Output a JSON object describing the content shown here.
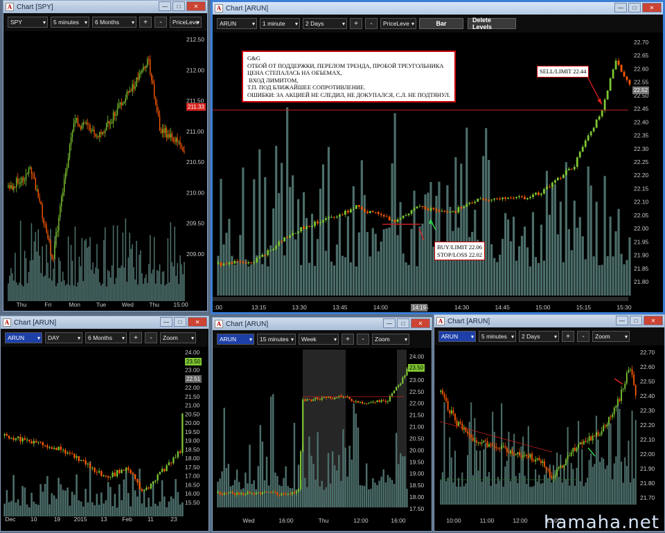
{
  "colors": {
    "up": "#7fc832",
    "down": "#ff5a00",
    "vol": "#4c6e6a",
    "level": "#cc2020"
  },
  "windows": {
    "spy": {
      "title": "Chart [SPY]",
      "symbol": "SPY",
      "interval": "5 minutes",
      "range": "6 Months",
      "price_type": "PriceLeve",
      "current_price": "211.33",
      "y_labels": [
        "212.50",
        "212.00",
        "211.50",
        "211.00",
        "210.50",
        "210.00",
        "209.50",
        "209.00"
      ],
      "x_labels": [
        "Thu",
        "Fri",
        "Mon",
        "Tue",
        "Wed",
        "Thu",
        "15:00"
      ]
    },
    "main": {
      "title": "Chart [ARUN]",
      "symbol": "ARUN",
      "interval": "1 minute",
      "range": "2 Days",
      "price_type": "PriceLeve",
      "bar_button": "Bar",
      "delete_button": "Delete Levels",
      "current_price": "22.52",
      "y_labels": [
        "22.70",
        "22.65",
        "22.60",
        "22.55",
        "22.50",
        "22.45",
        "22.40",
        "22.35",
        "22.30",
        "22.25",
        "22.20",
        "22.15",
        "22.10",
        "22.05",
        "22.00",
        "21.95",
        "21.90",
        "21.85",
        "21.80"
      ],
      "x_labels": [
        ":00",
        "13:15",
        "13:30",
        "13:45",
        "14:00",
        "14:15",
        "14:30",
        "14:45",
        "15:00",
        "15:15",
        "15:30"
      ],
      "time_cursor": "14:19",
      "note": "G&G\nОТБОЙ ОТ ПОДДЕРЖКИ, ПЕРЕЛОМ ТРЕНДА, ПРОБОЙ ТРЕУГОЛЬНИКА\nЦЕНА СТЕПАЛАСЬ НА ОБЪЕМАХ,\n ВХОД ЛИМИТОМ,\nТ.П. ПОД БЛИЖАЙШЕЕ СОПРОТИВЛЕНИЕ.\nОШИБКИ: ЗА АКЦИЕЙ НЕ СЛЕДИЛ, НЕ ДОКУПАЛСЯ, С.Л. НЕ ПОДТЯНУЛ.",
      "sell_label": "SELL/LIMIT 22.44",
      "buy_label": "BUY/LIMIT 22.06\nSTOP/LOSS 22.02"
    },
    "daily": {
      "title": "Chart [ARUN]",
      "symbol": "ARUN",
      "interval": "DAY",
      "range": "6 Months",
      "zoom": "Zoom",
      "price_a": "23.50",
      "price_b": "22.51",
      "y_labels": [
        "24.00",
        "23.50",
        "23.00",
        "22.50",
        "22.00",
        "21.50",
        "21.00",
        "20.50",
        "20.00",
        "19.50",
        "19.00",
        "18.50",
        "18.00",
        "17.50",
        "17.00",
        "16.50",
        "16.00",
        "15.50"
      ],
      "x_labels": [
        "Dec",
        "10",
        "19",
        "2015",
        "13",
        "Feb",
        "11",
        "23"
      ]
    },
    "m15": {
      "title": "Chart [ARUN]",
      "symbol": "ARUN",
      "interval": "15 minutes",
      "range": "Week",
      "zoom": "Zoom",
      "current_price": "23.50",
      "y_labels": [
        "24.00",
        "23.50",
        "23.00",
        "22.50",
        "22.00",
        "21.50",
        "21.00",
        "20.50",
        "20.00",
        "19.50",
        "19.00",
        "18.50",
        "18.00",
        "17.50"
      ],
      "x_labels": [
        "Wed",
        "16:00",
        "Thu",
        "12:00",
        "16:00"
      ]
    },
    "m5": {
      "title": "Chart [ARUN]",
      "symbol": "ARUN",
      "interval": "5 minutes",
      "range": "2 Days",
      "zoom": "Zoom",
      "y_labels": [
        "22.70",
        "22.60",
        "22.50",
        "22.40",
        "22.30",
        "22.20",
        "22.10",
        "22.00",
        "21.90",
        "21.80",
        "21.70"
      ],
      "x_labels": [
        "10:00",
        "11:00",
        "12:00",
        "13:00"
      ]
    }
  },
  "watermark": "hamaha.net"
}
